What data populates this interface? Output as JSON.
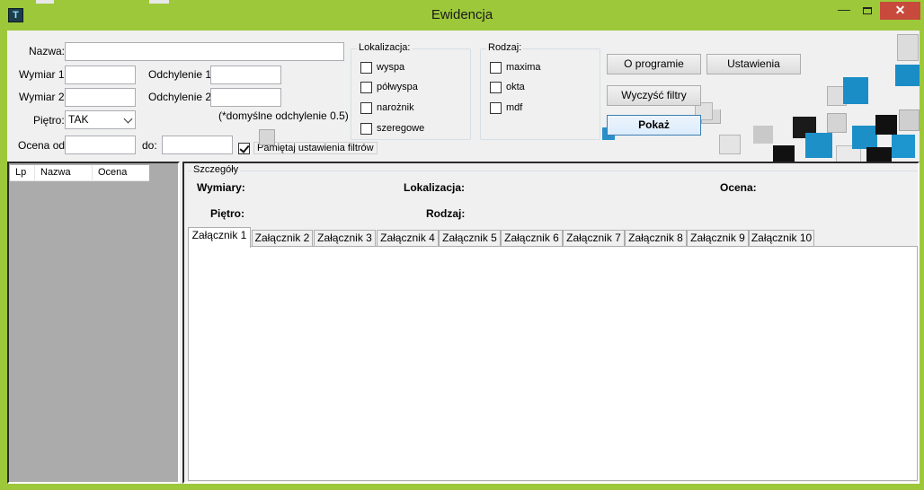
{
  "window": {
    "title": "Ewidencja",
    "icon": "app-icon",
    "icon_glyph": "T",
    "minimize_glyph": "—",
    "close_glyph": "✕"
  },
  "filters": {
    "nazwa_label": "Nazwa:",
    "nazwa_value": "",
    "wymiar1_label": "Wymiar 1:",
    "wymiar1_value": "",
    "odchylenie1_label": "Odchylenie 1:",
    "odchylenie1_value": "",
    "wymiar2_label": "Wymiar 2:",
    "wymiar2_value": "",
    "odchylenie2_label": "Odchylenie 2:",
    "odchylenie2_value": "",
    "pietro_label": "Piętro:",
    "pietro_value": "TAK",
    "default_note": "(*domyślne odchylenie 0.5)",
    "ocena_od_label": "Ocena od:",
    "ocena_od_value": "",
    "do_label": "do:",
    "do_value": "",
    "remember_label": "Pamiętaj ustawienia filtrów",
    "remember_checked": true
  },
  "lokalizacja": {
    "title": "Lokalizacja:",
    "options": [
      {
        "label": "wyspa",
        "checked": false
      },
      {
        "label": "półwyspa",
        "checked": false
      },
      {
        "label": "narożnik",
        "checked": false
      },
      {
        "label": "szeregowe",
        "checked": false
      }
    ]
  },
  "rodzaj": {
    "title": "Rodzaj:",
    "options": [
      {
        "label": "maxima",
        "checked": false
      },
      {
        "label": "okta",
        "checked": false
      },
      {
        "label": "mdf",
        "checked": false
      }
    ]
  },
  "buttons": {
    "about": "O programie",
    "settings": "Ustawienia",
    "clear": "Wyczyść filtry",
    "show": "Pokaż"
  },
  "list": {
    "columns": [
      "Lp",
      "Nazwa",
      "Ocena"
    ]
  },
  "details": {
    "title": "Szczegóły",
    "wymiary": "Wymiary:",
    "lokalizacja": "Lokalizacja:",
    "ocena": "Ocena:",
    "pietro": "Piętro:",
    "rodzaj": "Rodzaj:"
  },
  "tabs": [
    "Załącznik 1",
    "Załącznik 2",
    "Załącznik 3",
    "Załącznik 4",
    "Załącznik 5",
    "Załącznik 6",
    "Załącznik 7",
    "Załącznik 8",
    "Załącznik 9",
    "Załącznik 10"
  ],
  "active_tab": 0,
  "colors": {
    "window_frame": "#9dc83a",
    "close_button": "#c74a3c",
    "list_background": "#ababab",
    "cube_blue": "#1a8bbf",
    "cube_black": "#111111",
    "cube_gray": "#d0d0d0"
  }
}
